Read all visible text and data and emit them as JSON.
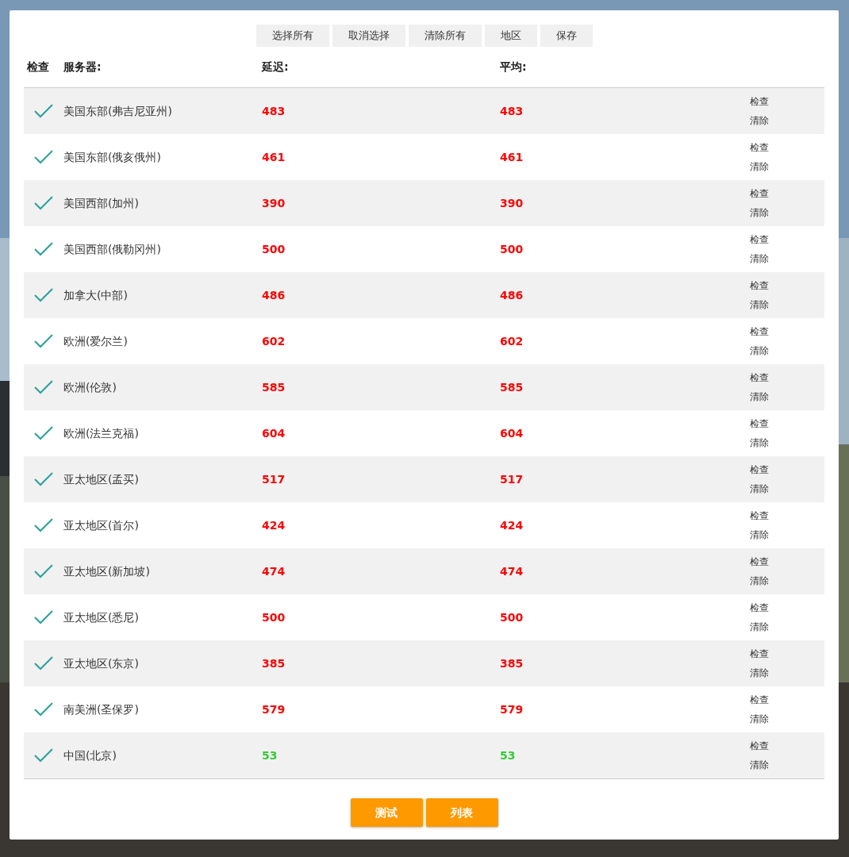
{
  "toolbar": [
    "选择所有",
    "取消选择",
    "清除所有",
    "地区",
    "保存"
  ],
  "columns": [
    "检查",
    "服务器:",
    "延迟:",
    "平均:"
  ],
  "rows": [
    {
      "checked": true,
      "server": "美国东部(弗吉尼亚州)",
      "latency": "483",
      "average": "483",
      "color": "#ff0000",
      "actions": [
        "检查",
        "清除"
      ]
    },
    {
      "checked": true,
      "server": "美国东部(俄亥俄州)",
      "latency": "461",
      "average": "461",
      "color": "#ff0000",
      "actions": [
        "检查",
        "清除"
      ]
    },
    {
      "checked": true,
      "server": "美国西部(加州)",
      "latency": "390",
      "average": "390",
      "color": "#ff0000",
      "actions": [
        "检查",
        "清除"
      ]
    },
    {
      "checked": true,
      "server": "美国西部(俄勒冈州)",
      "latency": "500",
      "average": "500",
      "color": "#ff0000",
      "actions": [
        "检查",
        "清除"
      ]
    },
    {
      "checked": true,
      "server": "加拿大(中部)",
      "latency": "486",
      "average": "486",
      "color": "#ff0000",
      "actions": [
        "检查",
        "清除"
      ]
    },
    {
      "checked": true,
      "server": "欧洲(爱尔兰)",
      "latency": "602",
      "average": "602",
      "color": "#ff0000",
      "actions": [
        "检查",
        "清除"
      ]
    },
    {
      "checked": true,
      "server": "欧洲(伦敦)",
      "latency": "585",
      "average": "585",
      "color": "#ff0000",
      "actions": [
        "检查",
        "清除"
      ]
    },
    {
      "checked": true,
      "server": "欧洲(法兰克福)",
      "latency": "604",
      "average": "604",
      "color": "#ff0000",
      "actions": [
        "检查",
        "清除"
      ]
    },
    {
      "checked": true,
      "server": "亚太地区(孟买)",
      "latency": "517",
      "average": "517",
      "color": "#ff0000",
      "actions": [
        "检查",
        "清除"
      ]
    },
    {
      "checked": true,
      "server": "亚太地区(首尔)",
      "latency": "424",
      "average": "424",
      "color": "#ff0000",
      "actions": [
        "检查",
        "清除"
      ]
    },
    {
      "checked": true,
      "server": "亚太地区(新加坡)",
      "latency": "474",
      "average": "474",
      "color": "#ff0000",
      "actions": [
        "检查",
        "清除"
      ]
    },
    {
      "checked": true,
      "server": "亚太地区(悉尼)",
      "latency": "500",
      "average": "500",
      "color": "#ff0000",
      "actions": [
        "检查",
        "清除"
      ]
    },
    {
      "checked": true,
      "server": "亚太地区(东京)",
      "latency": "385",
      "average": "385",
      "color": "#ff0000",
      "actions": [
        "检查",
        "清除"
      ]
    },
    {
      "checked": true,
      "server": "南美洲(圣保罗)",
      "latency": "579",
      "average": "579",
      "color": "#ff0000",
      "actions": [
        "检查",
        "清除"
      ]
    },
    {
      "checked": true,
      "server": "中国(北京)",
      "latency": "53",
      "average": "53",
      "color": "#33cc33",
      "actions": [
        "检查",
        "清除"
      ]
    }
  ],
  "buttons": [
    "测试",
    "列表"
  ]
}
